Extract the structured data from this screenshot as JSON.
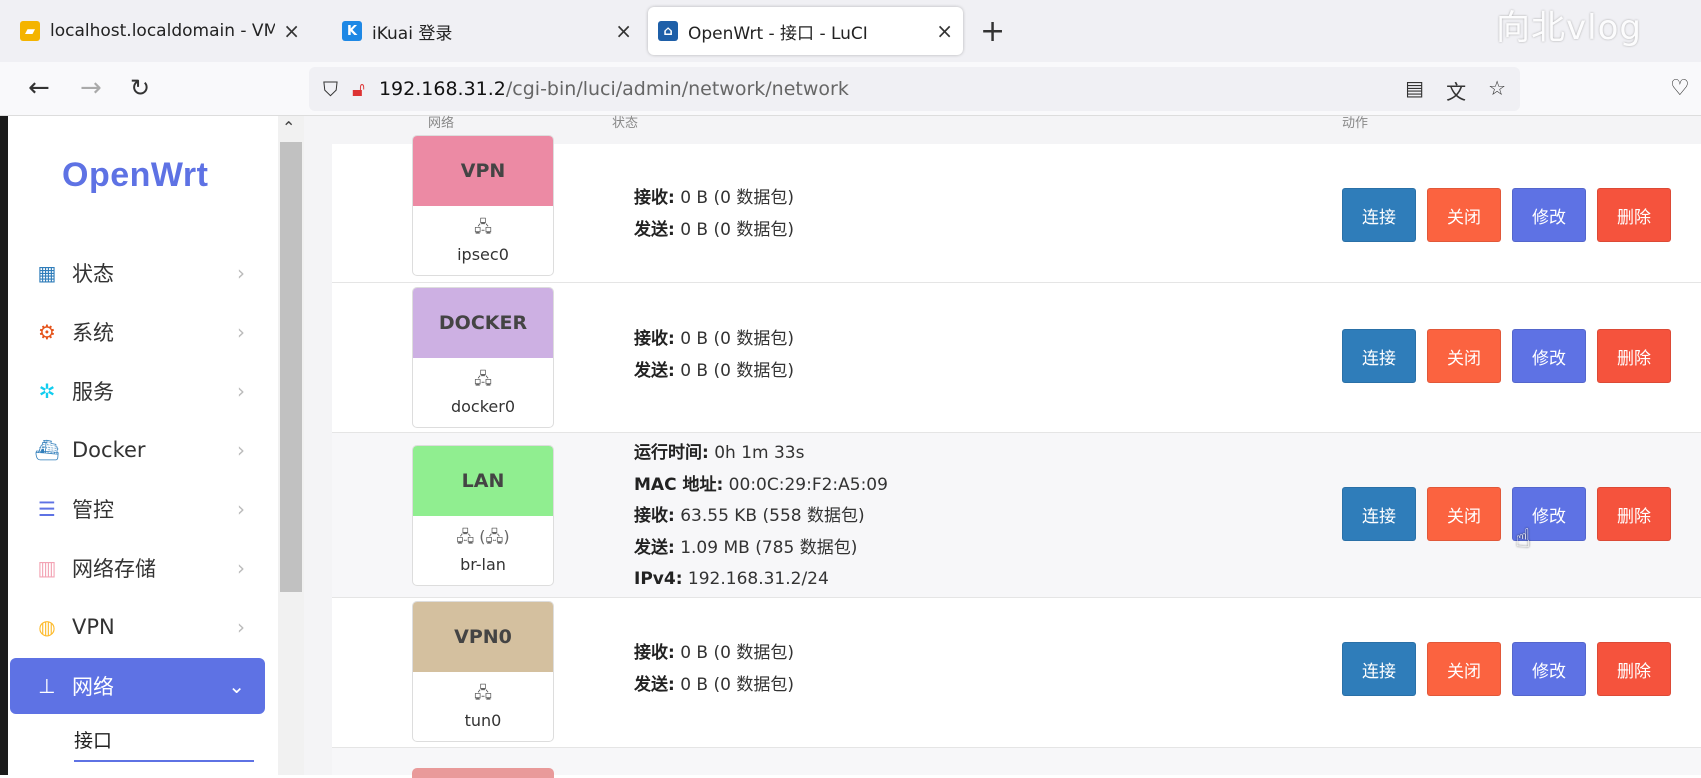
{
  "browser": {
    "tabs": [
      {
        "title": "localhost.localdomain - VMware",
        "favicon": "vmware-icon"
      },
      {
        "title": "iKuai 登录",
        "favicon": "ikuai-icon"
      },
      {
        "title": "OpenWrt - 接口 - LuCI",
        "favicon": "openwrt-icon",
        "active": true
      }
    ],
    "new_tab": "+",
    "url_host": "192.168.31.2",
    "url_path": "/cgi-bin/luci/admin/network/network",
    "watermark": "向北vlog"
  },
  "sidebar": {
    "logo": "OpenWrt",
    "items": [
      {
        "label": "状态",
        "icon": "dashboard-icon",
        "color": "#2f7dba"
      },
      {
        "label": "系统",
        "icon": "gear-icon",
        "color": "#e5531a"
      },
      {
        "label": "服务",
        "icon": "cogs-icon",
        "color": "#11cdef"
      },
      {
        "label": "Docker",
        "icon": "docker-icon",
        "color": "#2f7dba"
      },
      {
        "label": "管控",
        "icon": "sliders-icon",
        "color": "#5e72e4"
      },
      {
        "label": "网络存储",
        "icon": "database-icon",
        "color": "#f3a4b5"
      },
      {
        "label": "VPN",
        "icon": "globe-icon",
        "color": "#fdbb2d"
      },
      {
        "label": "网络",
        "icon": "sitemap-icon",
        "color": "#ffffff",
        "active": true
      }
    ],
    "submenu_active": "接口"
  },
  "table": {
    "headers": {
      "network": "网络",
      "status": "状态",
      "actions": "动作"
    },
    "buttons": {
      "connect": "连接",
      "stop": "关闭",
      "edit": "修改",
      "delete": "删除"
    },
    "rows": [
      {
        "name": "VPN",
        "color": "#ec8aa4",
        "device": "ipsec0",
        "device_icon": "ethernet-icon",
        "lines": [
          {
            "k": "接收:",
            "v": " 0 B (0 数据包)"
          },
          {
            "k": "发送:",
            "v": " 0 B (0 数据包)"
          }
        ]
      },
      {
        "name": "DOCKER",
        "color": "#cdb0e3",
        "device": "docker0",
        "device_icon": "ethernet-icon",
        "lines": [
          {
            "k": "接收:",
            "v": " 0 B (0 数据包)"
          },
          {
            "k": "发送:",
            "v": " 0 B (0 数据包)"
          }
        ]
      },
      {
        "name": "LAN",
        "color": "#90ee90",
        "device": "br-lan",
        "device_icon": "bridge-icon",
        "lines": [
          {
            "k": "运行时间:",
            "v": " 0h 1m 33s"
          },
          {
            "k": "MAC 地址:",
            "v": " 00:0C:29:F2:A5:09"
          },
          {
            "k": "接收:",
            "v": " 63.55 KB (558 数据包)"
          },
          {
            "k": "发送:",
            "v": " 1.09 MB (785 数据包)"
          },
          {
            "k": "IPv4:",
            "v": " 192.168.31.2/24"
          }
        ]
      },
      {
        "name": "VPN0",
        "color": "#d4c09f",
        "device": "tun0",
        "device_icon": "ethernet-icon",
        "lines": [
          {
            "k": "接收:",
            "v": " 0 B (0 数据包)"
          },
          {
            "k": "发送:",
            "v": " 0 B (0 数据包)"
          }
        ]
      }
    ]
  }
}
